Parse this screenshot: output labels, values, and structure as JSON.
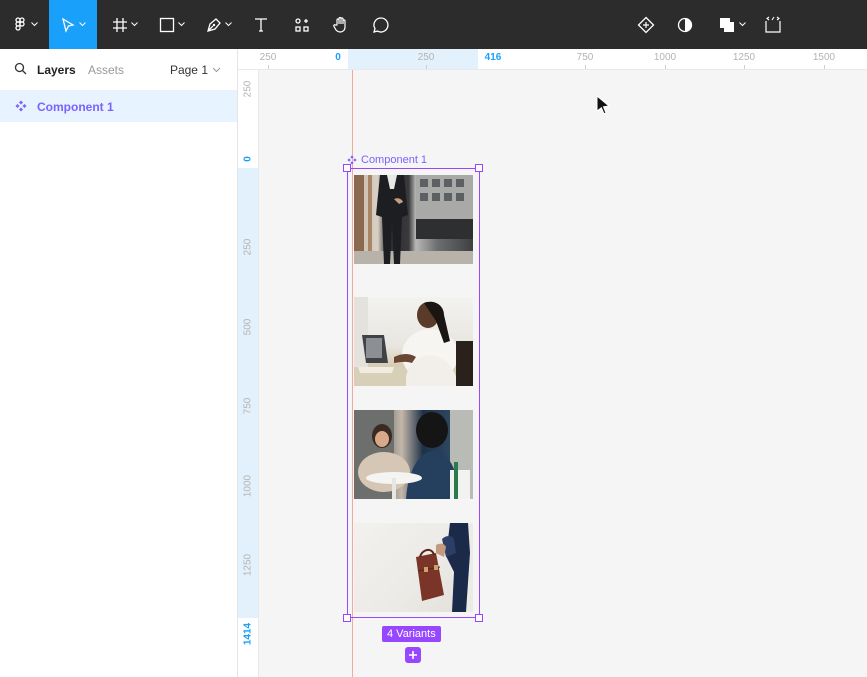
{
  "left_panel": {
    "tabs": {
      "layers": "Layers",
      "assets": "Assets"
    },
    "page_selector": "Page 1",
    "layers": [
      {
        "name": "Component 1",
        "type": "component"
      }
    ]
  },
  "ruler_top": [
    "250",
    "0",
    "250",
    "416",
    "750",
    "1000",
    "1250",
    "1500"
  ],
  "ruler_left": [
    "250",
    "0",
    "250",
    "500",
    "750",
    "1000",
    "1250",
    "1414"
  ],
  "canvas": {
    "component_name": "Component 1",
    "variants_label": "4 Variants",
    "variants": [
      {
        "name": "variant-businessman-walking"
      },
      {
        "name": "variant-woman-laptop"
      },
      {
        "name": "variant-meeting"
      },
      {
        "name": "variant-briefcase"
      }
    ]
  },
  "colors": {
    "toolbar_bg": "#2c2c2c",
    "active_tool": "#18a0fb",
    "component_purple": "#9747ff",
    "selection_highlight": "#e7f3fe"
  }
}
